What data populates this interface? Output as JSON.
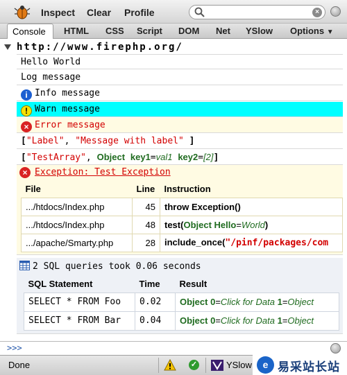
{
  "toolbar": {
    "inspect": "Inspect",
    "clear": "Clear",
    "profile": "Profile",
    "search_value": ""
  },
  "tabs": [
    "Console",
    "HTML",
    "CSS",
    "Script",
    "DOM",
    "Net",
    "YSlow",
    "Options"
  ],
  "console": {
    "group_title": "http://www.firephp.org/",
    "lines": {
      "hello": "Hello World",
      "log": "Log message",
      "info": "Info message",
      "warn": "Warn message",
      "error": "Error message"
    },
    "label_row": {
      "open": "[",
      "label": "\"Label\"",
      "comma": ", ",
      "message": "\"Message with label\"",
      "close": "]"
    },
    "array_row": {
      "open": "[",
      "label": "\"TestArray\"",
      "comma": ", ",
      "obj": "Object",
      "k1": "key1",
      "eq1": "=",
      "v1": "val1",
      "k2": "key2",
      "eq2": "=",
      "v2": "[2]",
      "close": "]"
    },
    "exception": {
      "title": "Exception: Test Exception",
      "headers": [
        "File",
        "Line",
        "Instruction"
      ],
      "rows": [
        {
          "file": ".../htdocs/Index.php",
          "line": "45",
          "instruction": "throw Exception()"
        },
        {
          "file": ".../htdocs/Index.php",
          "line": "48",
          "fn": "test(",
          "obj": "Object",
          "key": "Hello",
          "eq": "=",
          "val": "World",
          "close": ")"
        },
        {
          "file": ".../apache/Smarty.php",
          "line": "28",
          "fn": "include_once(",
          "str": "\"/pinf/packages/com"
        }
      ]
    },
    "sql": {
      "title": "2 SQL queries took 0.06 seconds",
      "headers": [
        "SQL Statement",
        "Time",
        "Result"
      ],
      "rows": [
        {
          "statement": "SELECT * FROM Foo",
          "time": "0.02",
          "obj": "Object",
          "k0": "0",
          "v0": "Click for Data",
          "k1": "1",
          "v1": "Object"
        },
        {
          "statement": "SELECT * FROM Bar",
          "time": "0.04",
          "obj": "Object",
          "k0": "0",
          "v0": "Click for Data",
          "k1": "1",
          "v1": "Object"
        }
      ]
    }
  },
  "command_line": {
    "prompt": ">>>"
  },
  "status_bar": {
    "text": "Done",
    "yslow": "YSlow"
  },
  "watermark": {
    "logo": "e",
    "text": "易采站长站"
  },
  "colors": {
    "warn_bg": "#00ffff",
    "error_text": "#d30000",
    "object_green": "#1f6b1f",
    "info_blue": "#1d5fd1"
  }
}
